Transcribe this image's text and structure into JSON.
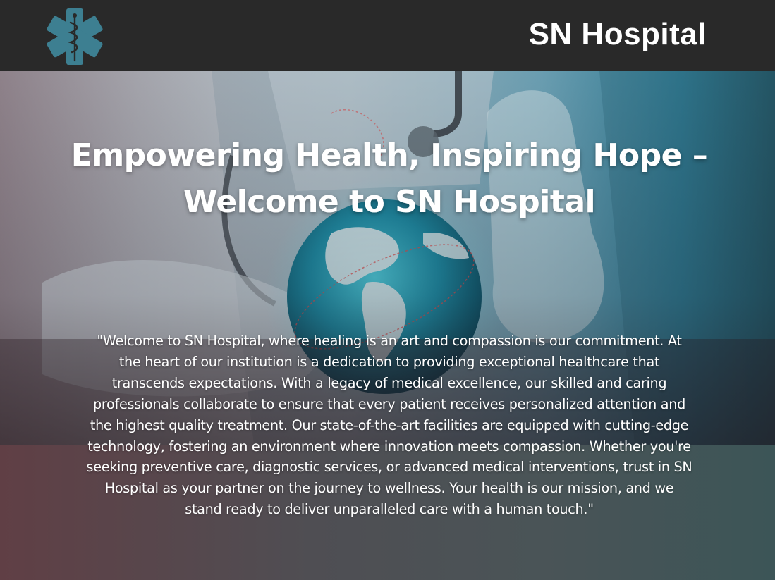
{
  "header": {
    "logo_icon": "star-of-life-icon",
    "brand_name": "SN Hospital"
  },
  "hero": {
    "background_image": "doctor-holding-globe-image",
    "headline": "Empowering Health, Inspiring Hope – Welcome to SN Hospital",
    "intro_text": "\"Welcome to SN Hospital, where healing is an art and compassion is our commitment. At the heart of our institution is a dedication to providing exceptional healthcare that transcends expectations. With a legacy of medical excellence, our skilled and caring professionals collaborate to ensure that every patient receives personalized attention and the highest quality treatment. Our state-of-the-art facilities are equipped with cutting-edge technology, fostering an environment where innovation meets compassion. Whether you're seeking preventive care, diagnostic services, or advanced medical interventions, trust in SN Hospital as your partner on the journey to wellness. Your health is our mission, and we stand ready to deliver unparalleled care with a human touch.\""
  },
  "colors": {
    "header_bg": "#292929",
    "logo_teal": "#3d7f91",
    "text": "#ffffff"
  }
}
